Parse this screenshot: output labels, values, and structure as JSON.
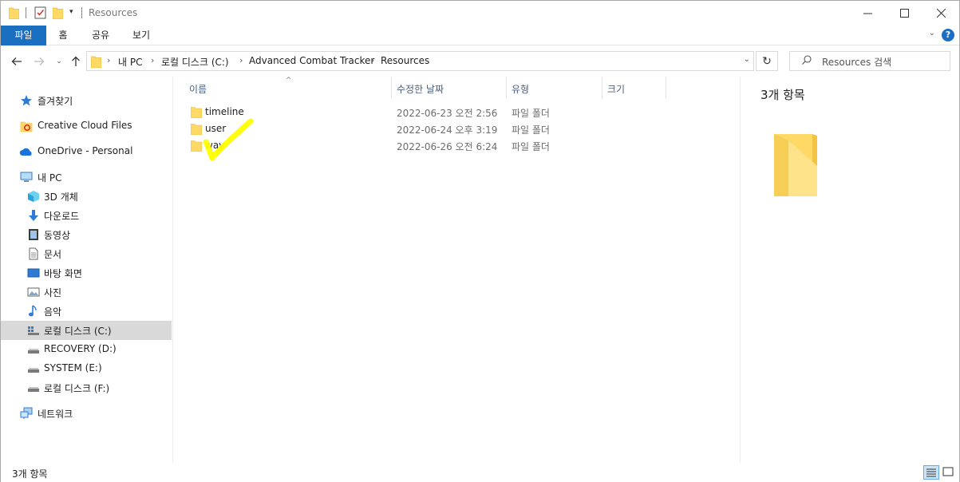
{
  "window": {
    "title": "Resources"
  },
  "ribbon": {
    "tabs": [
      "파일",
      "홈",
      "공유",
      "보기"
    ]
  },
  "address": {
    "crumbs": [
      "내 PC",
      "로컬 디스크 (C:)",
      "Advanced Combat Tracker",
      "Resources"
    ]
  },
  "search": {
    "placeholder": "Resources 검색"
  },
  "nav": {
    "items": [
      {
        "label": "즐겨찾기",
        "icon": "star-icon"
      },
      {
        "label": "Creative Cloud Files",
        "icon": "creative-cloud-folder-icon"
      },
      {
        "label": "OneDrive - Personal",
        "icon": "onedrive-cloud-icon"
      },
      {
        "label": "내 PC",
        "icon": "computer-icon"
      },
      {
        "label": "3D 개체",
        "icon": "3d-objects-icon"
      },
      {
        "label": "다운로드",
        "icon": "download-arrow-icon"
      },
      {
        "label": "동영상",
        "icon": "video-icon"
      },
      {
        "label": "문서",
        "icon": "document-icon"
      },
      {
        "label": "바탕 화면",
        "icon": "desktop-icon"
      },
      {
        "label": "사진",
        "icon": "pictures-icon"
      },
      {
        "label": "음악",
        "icon": "music-note-icon"
      },
      {
        "label": "로컬 디스크 (C:)",
        "icon": "windows-drive-icon"
      },
      {
        "label": "RECOVERY (D:)",
        "icon": "drive-icon"
      },
      {
        "label": "SYSTEM (E:)",
        "icon": "drive-icon"
      },
      {
        "label": "로컬 디스크 (F:)",
        "icon": "drive-icon"
      },
      {
        "label": "네트워크",
        "icon": "network-icon"
      }
    ]
  },
  "columns": {
    "name": "이름",
    "modified": "수정한 날짜",
    "type": "유형",
    "size": "크기"
  },
  "files": [
    {
      "name": "timeline",
      "modified": "2022-06-23 오전 2:56",
      "type": "파일 폴더"
    },
    {
      "name": "user",
      "modified": "2022-06-24 오후 3:19",
      "type": "파일 폴더"
    },
    {
      "name": "wav",
      "modified": "2022-06-26 오전 6:24",
      "type": "파일 폴더"
    }
  ],
  "preview": {
    "title": "3개 항목"
  },
  "status": {
    "count": "3개 항목"
  },
  "colors": {
    "accent": "#1a6fc1",
    "folder": "#ffd966",
    "selected_row": "#d9d9d9",
    "highlighter": "#ffff00"
  }
}
